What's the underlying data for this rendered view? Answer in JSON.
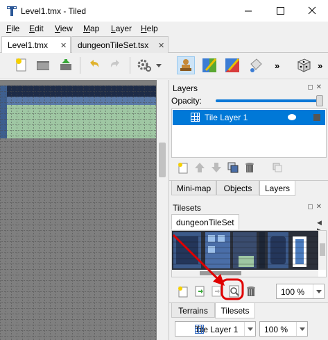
{
  "window": {
    "title": "Level1.tmx - Tiled",
    "minimize_glyph": "—",
    "maximize_glyph": "☐",
    "close_glyph": "✕"
  },
  "menu": {
    "items": [
      {
        "key": "F",
        "rest": "ile"
      },
      {
        "key": "E",
        "rest": "dit"
      },
      {
        "key": "V",
        "rest": "iew"
      },
      {
        "key": "M",
        "rest": "ap"
      },
      {
        "key": "L",
        "rest": "ayer"
      },
      {
        "key": "H",
        "rest": "elp"
      }
    ]
  },
  "tabs": [
    {
      "label": "Level1.tmx",
      "close": "✕",
      "active": true
    },
    {
      "label": "dungeonTileSet.tsx",
      "close": "✕",
      "active": false
    }
  ],
  "toolbar": {
    "icons": [
      "new-map-icon",
      "open-folder-icon",
      "save-icon",
      "undo-icon",
      "redo-icon",
      "gear-icon",
      "stamp-brush-icon",
      "terrain-brush-icon",
      "wang-brush-icon",
      "bucket-fill-icon",
      "random-dice-icon"
    ],
    "more": "»"
  },
  "layers_panel": {
    "title": "Layers",
    "dock_buttons": "◻✕",
    "opacity_label": "Opacity:",
    "opacity": 1.0,
    "layers": [
      {
        "name": "Tile Layer 1",
        "selected": true,
        "visible": true
      }
    ],
    "tabs": [
      "Mini-map",
      "Objects",
      "Layers"
    ],
    "active_tab": "Layers"
  },
  "tilesets_panel": {
    "title": "Tilesets",
    "dock_buttons": "◻✕",
    "tileset_tab": "dungeonTileSet",
    "nav": "◀ ▶",
    "zoom": "100 %",
    "tabs": [
      "Terrains",
      "Tilesets"
    ],
    "active_tab": "Tilesets"
  },
  "status": {
    "layer": "Tile Layer 1",
    "zoom": "100 %"
  },
  "colors": {
    "selection": "#0078d7",
    "annotation": "#e00000",
    "map_background": "#7f7f7f",
    "tile_blue": "#28466f",
    "tile_green": "#9fc7a3"
  }
}
